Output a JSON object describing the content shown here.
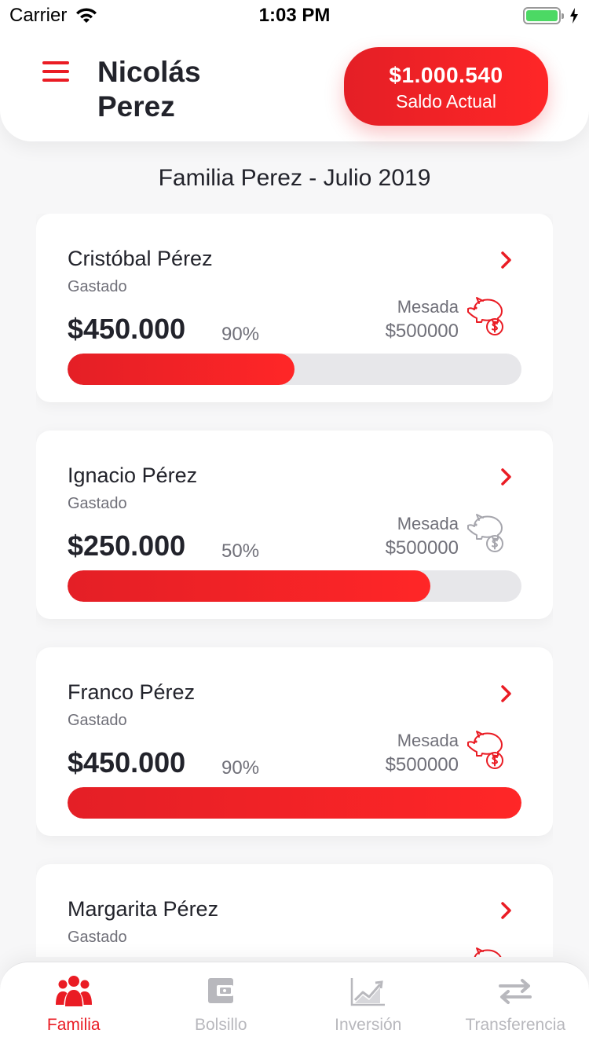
{
  "status_bar": {
    "carrier": "Carrier",
    "time": "1:03 PM"
  },
  "header": {
    "user_name": "Nicolás Perez",
    "balance_amount": "$1.000.540",
    "balance_label": "Saldo Actual"
  },
  "page_title": "Familia Perez - Julio 2019",
  "members": [
    {
      "name": "Cristóbal Pérez",
      "spent_label": "Gastado",
      "spent": "$450.000",
      "percent": "90%",
      "progress": 0.5,
      "mesada_label": "Mesada",
      "mesada": "$500000",
      "piggy_color": "#ea1c24"
    },
    {
      "name": "Ignacio Pérez",
      "spent_label": "Gastado",
      "spent": "$250.000",
      "percent": "50%",
      "progress": 0.8,
      "mesada_label": "Mesada",
      "mesada": "$500000",
      "piggy_color": "#a6a6ad"
    },
    {
      "name": "Franco Pérez",
      "spent_label": "Gastado",
      "spent": "$450.000",
      "percent": "90%",
      "progress": 1.0,
      "mesada_label": "Mesada",
      "mesada": "$500000",
      "piggy_color": "#ea1c24"
    },
    {
      "name": "Margarita Pérez",
      "spent_label": "Gastado",
      "spent": "",
      "percent": "",
      "progress": 0,
      "mesada_label": "",
      "mesada": "",
      "piggy_color": "#ea1c24"
    }
  ],
  "tabs": [
    {
      "label": "Familia",
      "icon": "family-icon",
      "active": true
    },
    {
      "label": "Bolsillo",
      "icon": "wallet-icon",
      "active": false
    },
    {
      "label": "Inversión",
      "icon": "chart-icon",
      "active": false
    },
    {
      "label": "Transferencia",
      "icon": "transfer-icon",
      "active": false
    }
  ],
  "colors": {
    "accent": "#ea1c24",
    "text": "#22232b",
    "muted": "#707079",
    "inactive": "#b8b8bd"
  }
}
